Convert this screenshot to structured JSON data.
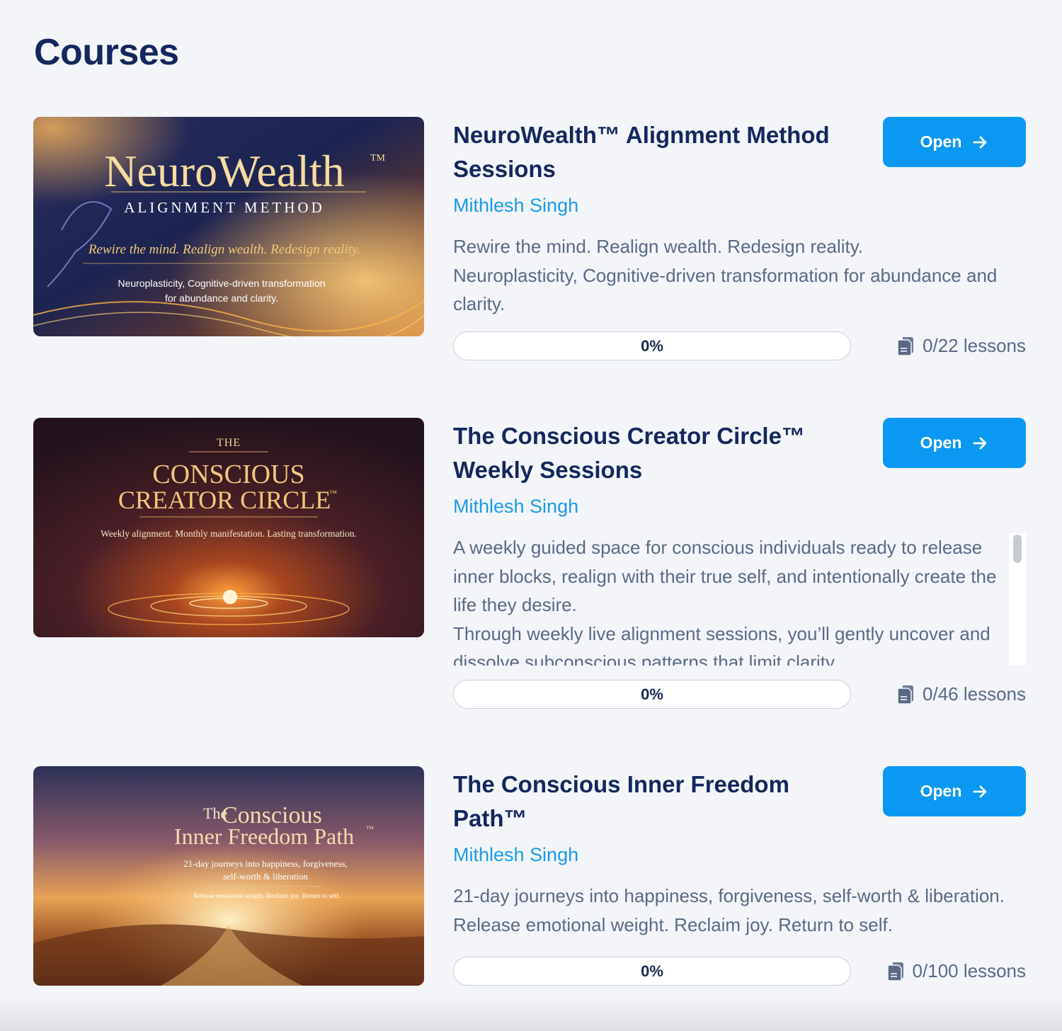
{
  "page": {
    "title": "Courses"
  },
  "colors": {
    "accent": "#0b98f2",
    "title": "#14275e",
    "author": "#1a9be8",
    "muted": "#5a6a85"
  },
  "courses": [
    {
      "title": "NeuroWealth™ Alignment Method Sessions",
      "author": "Mithlesh Singh",
      "description": [
        "Rewire the mind. Realign wealth. Redesign reality.",
        "Neuroplasticity, Cognitive-driven transformation for abundance and clarity."
      ],
      "progress": 0,
      "progress_label": "0%",
      "lessons": "0/22 lessons",
      "open_label": "Open",
      "thumbnail": {
        "heading": "NeuroWealth",
        "tm": "TM",
        "subheading": "ALIGNMENT METHOD",
        "tagline": "Rewire the mind. Realign wealth. Redesign reality.",
        "line1": "Neuroplasticity, Cognitive-driven transformation",
        "line2": "for abundance and clarity."
      }
    },
    {
      "title": "The Conscious Creator Circle™ Weekly Sessions",
      "author": "Mithlesh Singh",
      "description": [
        "A weekly guided space for conscious individuals ready to release inner blocks, realign with their true self, and intentionally create the life they desire.",
        "Through weekly live alignment sessions, you’ll gently uncover and dissolve subconscious patterns that limit clarity"
      ],
      "progress": 0,
      "progress_label": "0%",
      "lessons": "0/46 lessons",
      "open_label": "Open",
      "thumbnail": {
        "pre": "THE",
        "line1": "CONSCIOUS",
        "line2": "CREATOR CIRCLE",
        "tm": "™",
        "tagline": "Weekly alignment. Monthly manifestation. Lasting transformation."
      }
    },
    {
      "title": "The Conscious Inner Freedom Path™",
      "author": "Mithlesh Singh",
      "description": [
        "21-day journeys into happiness, forgiveness, self-worth & liberation. Release emotional weight. Reclaim joy. Return to self."
      ],
      "progress": 0,
      "progress_label": "0%",
      "lessons": "0/100 lessons",
      "open_label": "Open",
      "thumbnail": {
        "pre": "The",
        "line1": "Conscious",
        "line2": "Inner Freedom Path",
        "tm": "™",
        "sub1": "21-day journeys into happiness, forgiveness,",
        "sub2": "self-worth & liberation",
        "tagline": "Release emotional weight. Reclaim joy. Return to self."
      }
    }
  ]
}
